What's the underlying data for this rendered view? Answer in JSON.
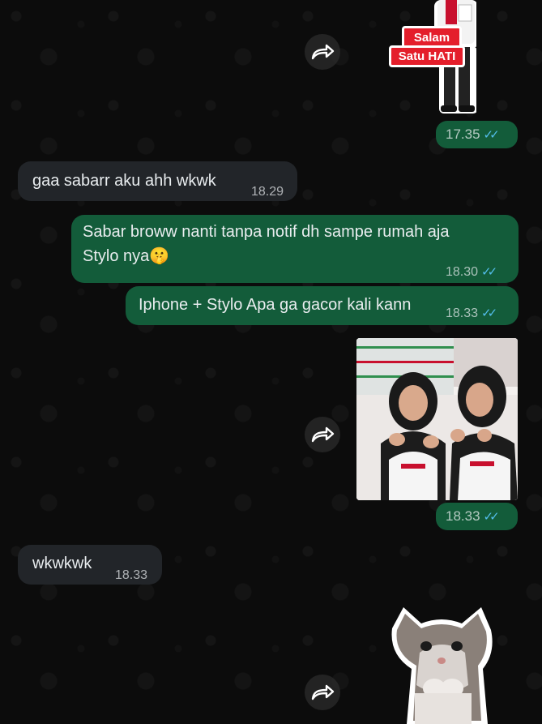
{
  "sticker_top": {
    "line1": "Salam",
    "line2": "Satu HATI",
    "time": "17.35"
  },
  "messages": [
    {
      "text": "gaa sabarr aku ahh wkwk",
      "time": "18.29"
    },
    {
      "line1": "Sabar broww nanti tanpa notif dh sampe rumah aja",
      "line2": "Stylo nya",
      "emoji": "🤫",
      "time": "18.30"
    },
    {
      "text": "Iphone + Stylo Apa ga gacor kali kann",
      "time": "18.33"
    },
    {
      "text": "wkwkwk",
      "time": "18.33"
    }
  ],
  "photo_time": "18.33",
  "ticks": "✓✓",
  "colors": {
    "incoming_bubble": "#222529",
    "outgoing_bubble": "#135c3a",
    "read_ticks": "#53bdeb",
    "background": "#0c0c0c"
  }
}
